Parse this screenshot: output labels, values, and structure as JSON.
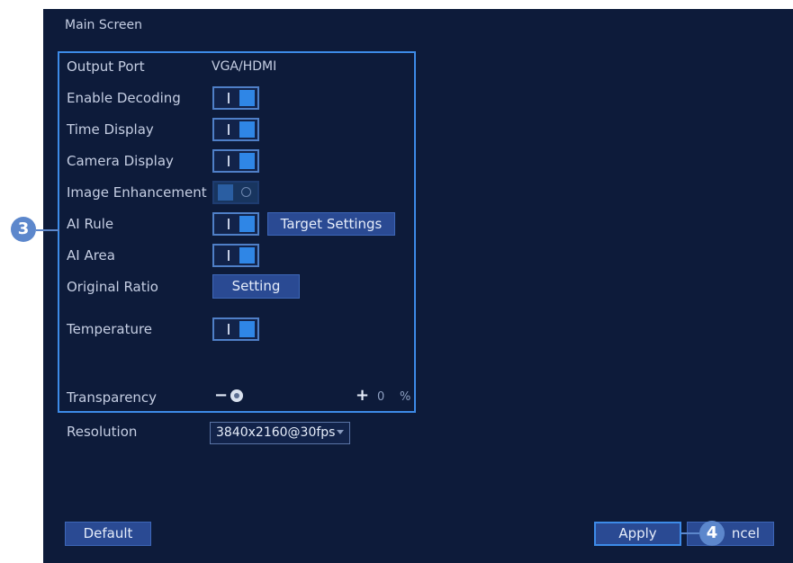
{
  "header": {
    "title": "Main Screen"
  },
  "settings": {
    "output_port": {
      "label": "Output Port",
      "value": "VGA/HDMI"
    },
    "enable_decoding": {
      "label": "Enable Decoding",
      "on": true
    },
    "time_display": {
      "label": "Time Display",
      "on": true
    },
    "camera_display": {
      "label": "Camera Display",
      "on": true
    },
    "image_enhancement": {
      "label": "Image Enhancement",
      "on": false
    },
    "ai_rule": {
      "label": "AI Rule",
      "on": true,
      "button": "Target Settings"
    },
    "ai_area": {
      "label": "AI Area",
      "on": true
    },
    "original_ratio": {
      "label": "Original Ratio",
      "button": "Setting"
    },
    "temperature": {
      "label": "Temperature",
      "on": true
    },
    "transparency": {
      "label": "Transparency",
      "minus": "−",
      "plus": "+",
      "value": "0",
      "unit": "%",
      "level": 0
    },
    "resolution": {
      "label": "Resolution",
      "value": "3840x2160@30fps"
    }
  },
  "toggle_glyph": "I",
  "footer": {
    "default_label": "Default",
    "apply_label": "Apply",
    "cancel_label": "ncel"
  },
  "callouts": {
    "left": "3",
    "right": "4"
  },
  "colors": {
    "background": "#0d1b3a",
    "accent": "#2f86e6",
    "frame": "#3d8be8",
    "callout": "#5c87cc"
  }
}
